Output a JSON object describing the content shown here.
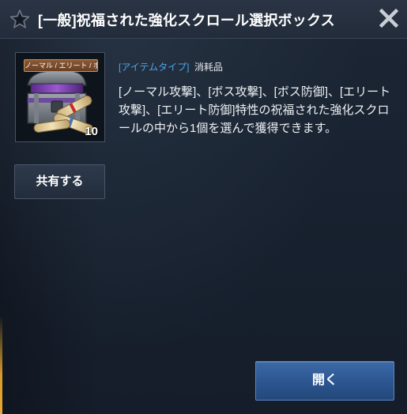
{
  "dialog": {
    "title": "[一般]祝福された強化スクロール選択ボックス",
    "star_icon": "star-icon",
    "close_icon": "close-icon"
  },
  "item": {
    "tag": "ノーマル / エリート / ボス",
    "count": "10",
    "type_label": "[アイテムタイプ]",
    "type_value": "消耗品",
    "description": "[ノーマル攻撃]、[ボス攻撃]、[ボス防御]、[エリート攻撃]、[エリート防御]特性の祝福された強化スクロールの中から1個を選んで獲得できます。"
  },
  "buttons": {
    "share_label": "共有する",
    "open_label": "開く"
  },
  "colors": {
    "type_label": "#4aa6e8",
    "open_button": "#2c5590",
    "accent_left": "#e8a932"
  }
}
